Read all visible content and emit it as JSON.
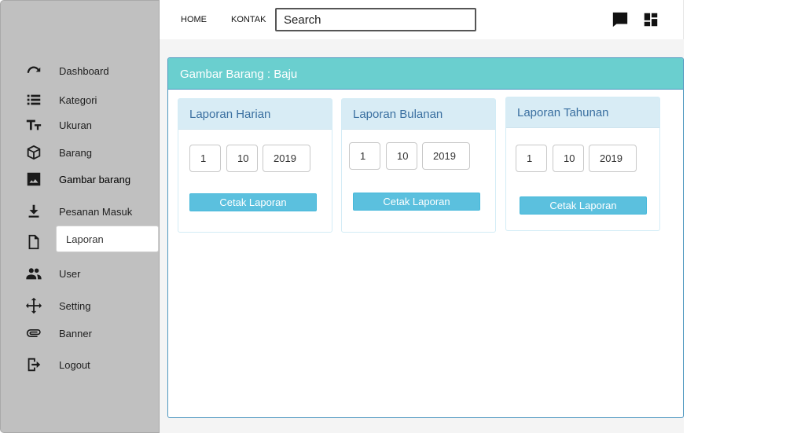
{
  "sidebar": {
    "items": [
      {
        "label": "Dashboard",
        "icon": "dashboard-icon"
      },
      {
        "label": "Kategori",
        "icon": "list-icon"
      },
      {
        "label": "Ukuran",
        "icon": "text-size-icon"
      },
      {
        "label": "Barang",
        "icon": "box-icon"
      },
      {
        "label": "Gambar barang",
        "icon": "image-icon"
      },
      {
        "label": "Pesanan Masuk",
        "icon": "download-icon"
      },
      {
        "label": "Laporan",
        "icon": "file-icon"
      },
      {
        "label": "User",
        "icon": "users-icon"
      },
      {
        "label": "Setting",
        "icon": "move-icon"
      },
      {
        "label": "Banner",
        "icon": "paperclip-icon"
      },
      {
        "label": "Logout",
        "icon": "logout-icon"
      }
    ]
  },
  "topbar": {
    "home": "HOME",
    "kontak": "KONTAK",
    "search_placeholder": "Search",
    "icons": [
      "chat-icon",
      "dashboard-grid-icon"
    ]
  },
  "panel": {
    "title": "Gambar Barang : Baju"
  },
  "cards": [
    {
      "title": "Laporan Harian",
      "day": "1",
      "month": "10",
      "year": "2019",
      "button": "Cetak Laporan"
    },
    {
      "title": "Laporan Bulanan",
      "day": "1",
      "month": "10",
      "year": "2019",
      "button": "Cetak Laporan"
    },
    {
      "title": "Laporan Tahunan",
      "day": "1",
      "month": "10",
      "year": "2019",
      "button": "Cetak Laporan"
    }
  ],
  "colors": {
    "sidebar": "#c0c0c0",
    "panel_header": "#6acfcf",
    "card_header": "#d8ecf5",
    "button": "#5bc0de"
  }
}
